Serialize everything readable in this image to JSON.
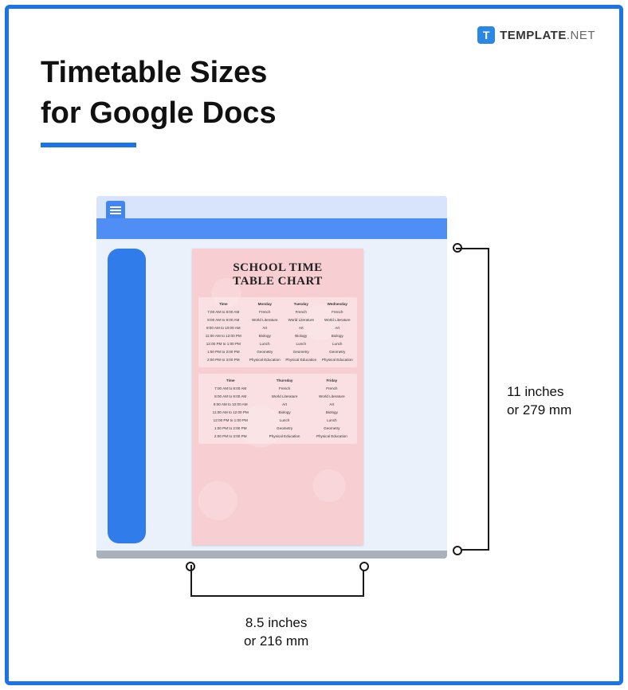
{
  "brand": {
    "icon_letter": "T",
    "name_bold": "TEMPLATE",
    "name_light": ".NET"
  },
  "title": {
    "line1": "Timetable Sizes",
    "line2": "for Google Docs"
  },
  "doc": {
    "heading_l1": "SCHOOL TIME",
    "heading_l2": "TABLE CHART",
    "section1": {
      "head": [
        "Time",
        "Monday",
        "Tuesday",
        "Wednesday"
      ],
      "rows": [
        [
          "7:00 AM to 8:00 AM",
          "French",
          "French",
          "French"
        ],
        [
          "8:00 AM to 9:00 AM",
          "World Literature",
          "World Literature",
          "World Literature"
        ],
        [
          "9:00 AM to 10:00 AM",
          "Art",
          "Art",
          "Art"
        ],
        [
          "11:00 AM to 12:00 PM",
          "Biology",
          "Biology",
          "Biology"
        ],
        [
          "12:00 PM to 1:00 PM",
          "Lunch",
          "Lunch",
          "Lunch"
        ],
        [
          "1:00 PM to 2:00 PM",
          "Geometry",
          "Geometry",
          "Geometry"
        ],
        [
          "2:00 PM to 3:00 PM",
          "Physical Education",
          "Physical Education",
          "Physical Education"
        ]
      ]
    },
    "section2": {
      "head": [
        "Time",
        "Thursday",
        "Friday"
      ],
      "rows": [
        [
          "7:00 AM to 8:00 AM",
          "French",
          "French"
        ],
        [
          "8:00 AM to 9:00 AM",
          "World Literature",
          "World Literature"
        ],
        [
          "9:00 AM to 10:00 AM",
          "Art",
          "Art"
        ],
        [
          "11:00 AM to 12:00 PM",
          "Biology",
          "Biology"
        ],
        [
          "12:00 PM to 1:00 PM",
          "Lunch",
          "Lunch"
        ],
        [
          "1:00 PM to 2:00 PM",
          "Geometry",
          "Geometry"
        ],
        [
          "2:00 PM to 3:00 PM",
          "Physical Education",
          "Physical Education"
        ]
      ]
    }
  },
  "dims": {
    "height_l1": "11 inches",
    "height_l2": "or 279 mm",
    "width_l1": "8.5 inches",
    "width_l2": "or 216 mm"
  }
}
